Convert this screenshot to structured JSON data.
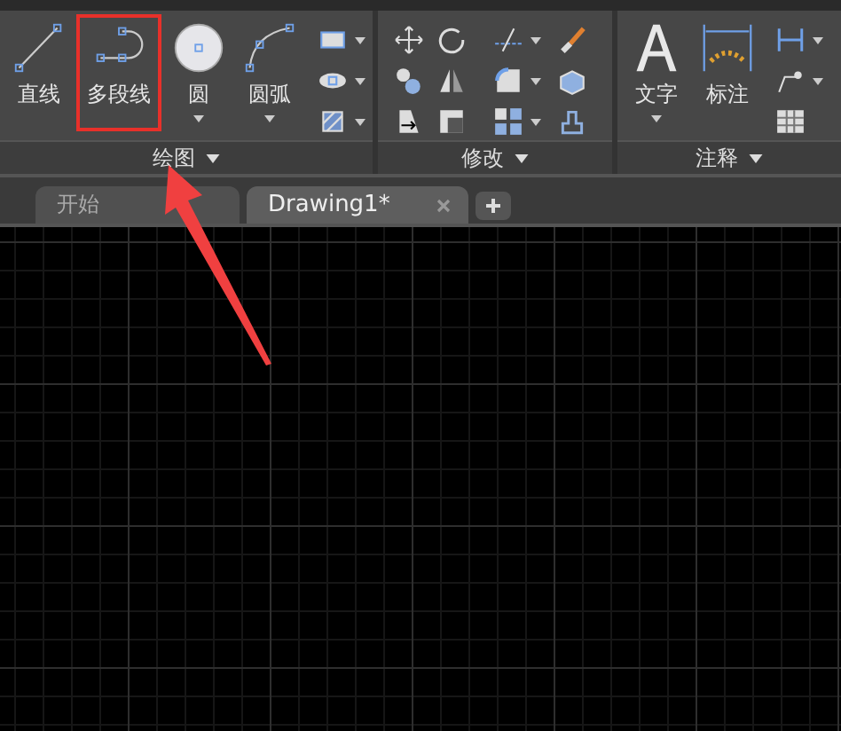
{
  "ribbon": {
    "panels": [
      {
        "kind": "draw",
        "title": "绘图",
        "tools": [
          {
            "kind": "line",
            "label": "直线",
            "dropdown": false,
            "highlighted": false
          },
          {
            "kind": "polyline",
            "label": "多段线",
            "dropdown": false,
            "highlighted": true
          },
          {
            "kind": "circle",
            "label": "圆",
            "dropdown": true,
            "highlighted": false
          },
          {
            "kind": "arc",
            "label": "圆弧",
            "dropdown": true,
            "highlighted": false
          }
        ]
      },
      {
        "kind": "modify",
        "title": "修改"
      },
      {
        "kind": "annotate",
        "title": "注释",
        "tools": [
          {
            "kind": "text",
            "label": "文字",
            "dropdown": true,
            "highlighted": false
          },
          {
            "kind": "dimension",
            "label": "标注",
            "dropdown": false,
            "highlighted": false
          }
        ]
      }
    ]
  },
  "tabs": [
    {
      "label": "开始",
      "selected": false,
      "closable": false
    },
    {
      "label": "Drawing1*",
      "selected": true,
      "closable": true
    }
  ]
}
